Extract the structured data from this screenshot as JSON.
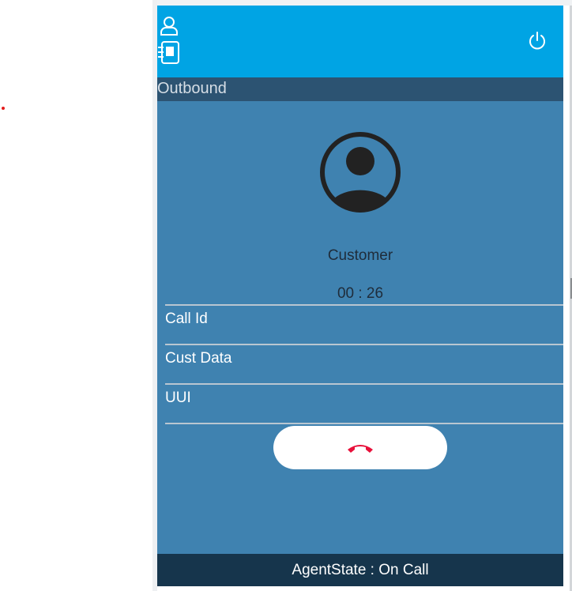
{
  "header": {
    "icons": [
      "user-icon",
      "contacts-book-icon",
      "power-icon"
    ],
    "color": "#00a4e4"
  },
  "call": {
    "direction": "Outbound",
    "caller": "Customer",
    "timer": "00 : 26",
    "fields": [
      "Call Id",
      "Cust Data",
      "UUI"
    ],
    "hangup_icon": "hangup-phone-icon",
    "hangup_color": "#e8103a"
  },
  "footer": {
    "agent_state": "AgentState : On Call"
  }
}
